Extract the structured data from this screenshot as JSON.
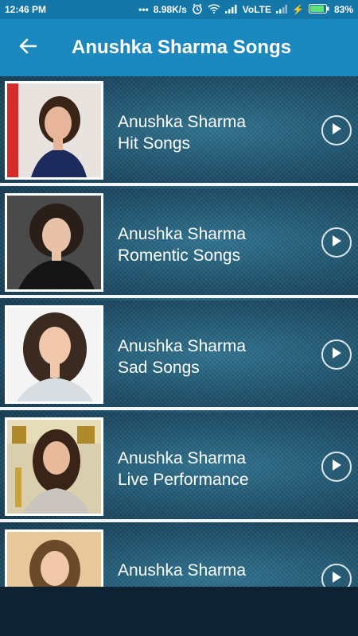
{
  "status_bar": {
    "time": "12:46 PM",
    "speed": "8.98K/s",
    "network": "VoLTE",
    "battery": "83%"
  },
  "app_bar": {
    "title": "Anushka Sharma Songs",
    "back_icon": "arrow-left-icon"
  },
  "colors": {
    "status_bar": "#1577a7",
    "app_bar": "#1b88c0",
    "list_bg": "#1f5570",
    "divider": "#f3f6f8"
  },
  "items": [
    {
      "line1": "Anushka Sharma",
      "line2": "Hit Songs",
      "icon": "play-icon"
    },
    {
      "line1": "Anushka Sharma",
      "line2": "Romentic Songs",
      "icon": "play-icon"
    },
    {
      "line1": "Anushka Sharma",
      "line2": "Sad Songs",
      "icon": "play-icon"
    },
    {
      "line1": "Anushka Sharma",
      "line2": "Live Performance",
      "icon": "play-icon"
    },
    {
      "line1": "Anushka Sharma",
      "line2": "",
      "icon": "play-icon"
    }
  ]
}
